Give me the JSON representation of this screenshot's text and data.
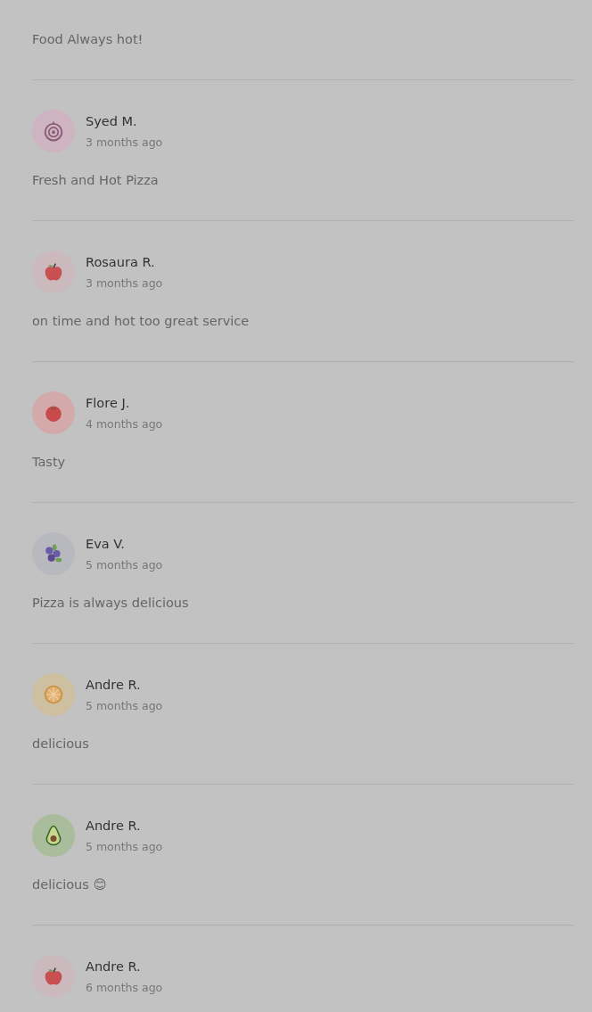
{
  "reviews": [
    {
      "comment": "Food Always hot!"
    },
    {
      "name": "Syed M.",
      "time": "3 months ago",
      "comment": "Fresh and Hot Pizza",
      "avatar": {
        "kind": "onion",
        "color": "#cdb4c0"
      }
    },
    {
      "name": "Rosaura R.",
      "time": "3 months ago",
      "comment": "on time and hot too great service",
      "avatar": {
        "kind": "apple",
        "color": "#cbb9bd"
      }
    },
    {
      "name": "Flore J.",
      "time": "4 months ago",
      "comment": "Tasty",
      "avatar": {
        "kind": "tomato",
        "color": "#d3a9a9"
      }
    },
    {
      "name": "Eva V.",
      "time": "5 months ago",
      "comment": "Pizza is always delicious",
      "avatar": {
        "kind": "berries",
        "color": "#b8b8bf"
      }
    },
    {
      "name": "Andre R.",
      "time": "5 months ago",
      "comment": "delicious",
      "avatar": {
        "kind": "orange",
        "color": "#cdbf9f"
      }
    },
    {
      "name": "Andre R.",
      "time": "5 months ago",
      "comment": "delicious 😊",
      "avatar": {
        "kind": "avocado",
        "color": "#a9bd9c"
      }
    },
    {
      "name": "Andre R.",
      "time": "6 months ago",
      "avatar": {
        "kind": "apple",
        "color": "#cbb9bd"
      }
    }
  ]
}
